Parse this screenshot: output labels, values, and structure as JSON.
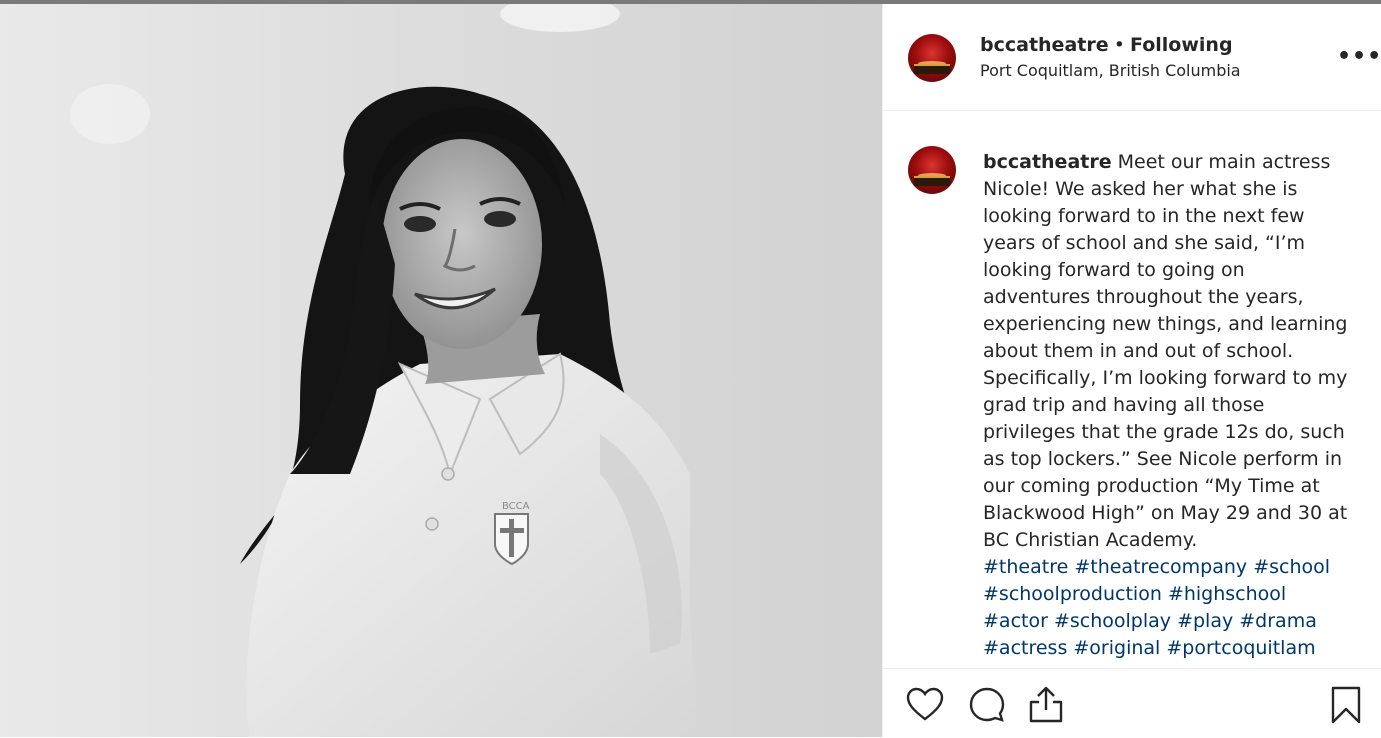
{
  "post": {
    "username": "bccatheatre",
    "separator": "•",
    "follow_status": "Following",
    "location": "Port Coquitlam, British Columbia",
    "more_label": "•••"
  },
  "caption": {
    "username": "bccatheatre",
    "text": "Meet our main actress Nicole! We asked her what she is looking forward to in the next few years of school and she said, “I’m looking forward to going on adventures throughout the years, experiencing new things, and learning about them in and out of school. Specifically, I’m looking forward to my grad trip and having all those privileges that the grade 12s do, such as top lockers.” See Nicole perform in our coming production “My Time at Blackwood High” on May 29 and 30 at BC Christian Academy.",
    "hashtags": [
      "#theatre",
      "#theatrecompany",
      "#school",
      "#schoolproduction",
      "#highschool",
      "#actor",
      "#schoolplay",
      "#play",
      "#drama",
      "#actress",
      "#original",
      "#portcoquitlam"
    ]
  },
  "photo": {
    "crest_text": "BCCA"
  },
  "icons": [
    "heart-icon",
    "comment-icon",
    "share-icon",
    "bookmark-icon"
  ],
  "colors": {
    "hashtag": "#00376b",
    "text": "#262626",
    "divider": "#efefef"
  }
}
